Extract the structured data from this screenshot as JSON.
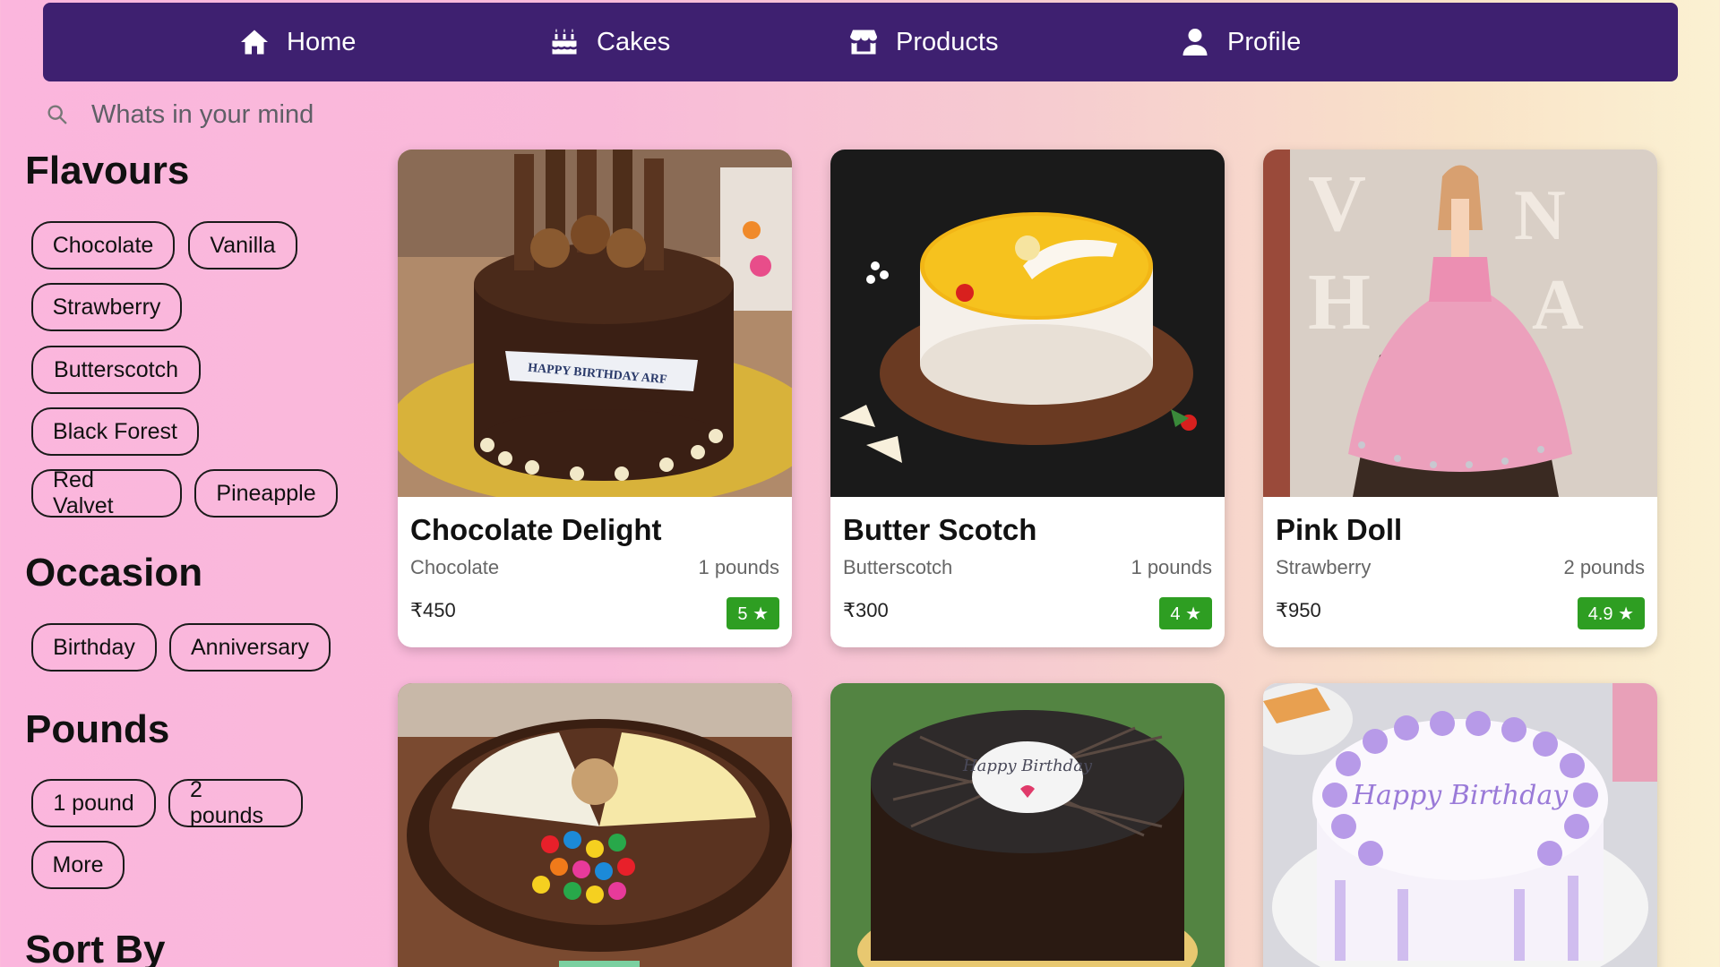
{
  "nav": {
    "items": [
      {
        "label": "Home",
        "icon": "home-icon"
      },
      {
        "label": "Cakes",
        "icon": "cake-icon"
      },
      {
        "label": "Products",
        "icon": "store-icon"
      },
      {
        "label": "Profile",
        "icon": "user-icon"
      }
    ]
  },
  "search": {
    "placeholder": "Whats in your mind",
    "icon": "search-icon"
  },
  "sidebar": {
    "flavours_title": "Flavours",
    "flavours": [
      "Chocolate",
      "Vanilla",
      "Strawberry",
      "Butterscotch",
      "Black Forest",
      "Red Valvet",
      "Pineapple"
    ],
    "occasion_title": "Occasion",
    "occasions": [
      "Birthday",
      "Anniversary"
    ],
    "pounds_title": "Pounds",
    "pounds": [
      "1 pound",
      "2 pounds",
      "More"
    ],
    "sort_title": "Sort By"
  },
  "products": [
    {
      "name": "Chocolate Delight",
      "flavour": "Chocolate",
      "weight": "1 pounds",
      "price": "₹450",
      "rating": "5 ★"
    },
    {
      "name": "Butter Scotch",
      "flavour": "Butterscotch",
      "weight": "1 pounds",
      "price": "₹300",
      "rating": "4 ★"
    },
    {
      "name": "Pink Doll",
      "flavour": "Strawberry",
      "weight": "2 pounds",
      "price": "₹950",
      "rating": "4.9 ★"
    }
  ],
  "cake_images": {
    "chocolate_delight_banner": "HAPPY BIRTHDAY ARF",
    "black_forest_topper": "Happy Birthday",
    "vanilla_writing": "Happy Birthday"
  },
  "colors": {
    "nav_bg": "#3e2070",
    "rating_bg": "#2e9e22"
  }
}
